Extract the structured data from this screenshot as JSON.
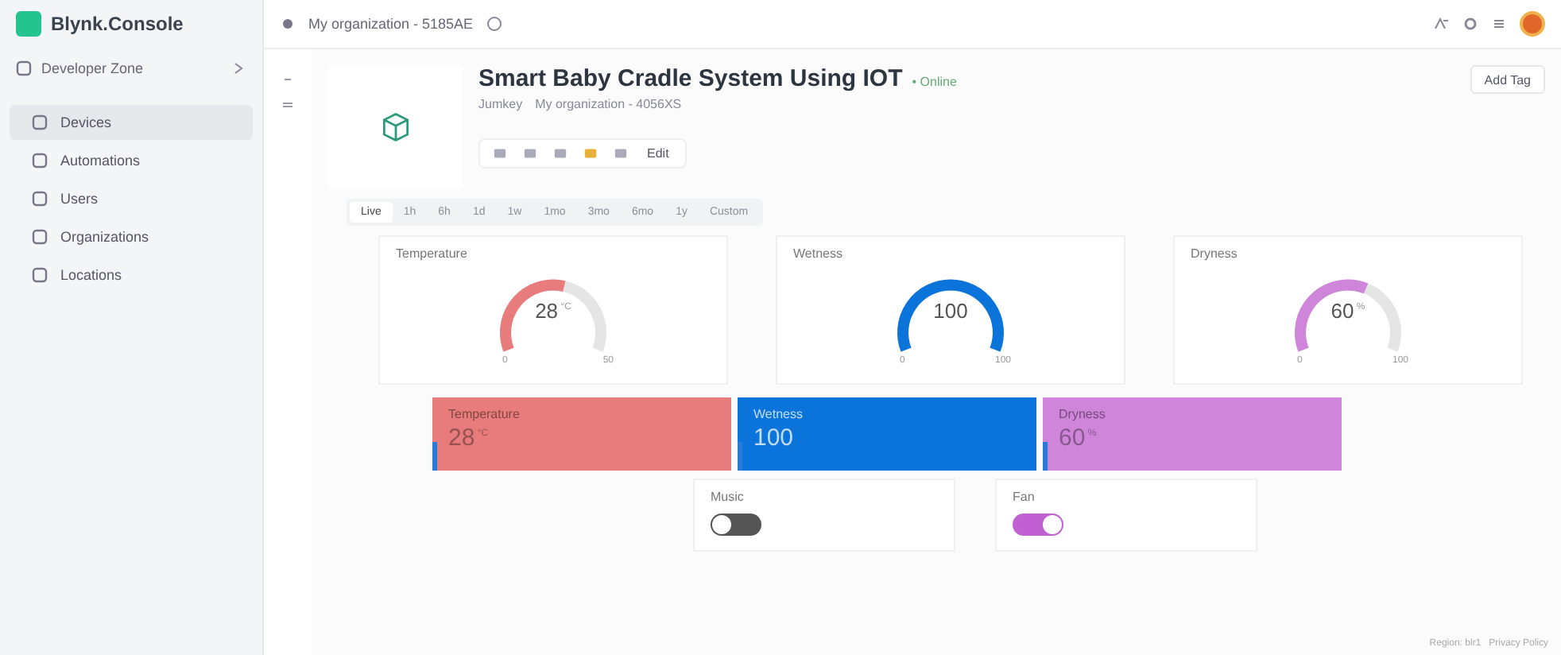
{
  "brand": {
    "name": "Blynk.Console"
  },
  "topbar": {
    "org": "My organization - 5185AE"
  },
  "sidebar": {
    "zone": "Developer Zone",
    "items": [
      {
        "label": "Devices",
        "selected": true
      },
      {
        "label": "Automations",
        "selected": false
      },
      {
        "label": "Users",
        "selected": false
      },
      {
        "label": "Organizations",
        "selected": false
      },
      {
        "label": "Locations",
        "selected": false
      }
    ]
  },
  "device": {
    "title": "Smart Baby Cradle System Using IOT",
    "status": "• Online",
    "owner": "Jumkey",
    "org": "My organization - 4056XS",
    "edit": "Edit",
    "add_tag": "Add Tag"
  },
  "time_tabs": [
    {
      "label": "Live",
      "selected": true
    },
    {
      "label": "1h",
      "selected": false
    },
    {
      "label": "6h",
      "selected": false
    },
    {
      "label": "1d",
      "selected": false
    },
    {
      "label": "1w",
      "selected": false
    },
    {
      "label": "1mo",
      "selected": false
    },
    {
      "label": "3mo",
      "selected": false
    },
    {
      "label": "6mo",
      "selected": false
    },
    {
      "label": "1y",
      "selected": false
    },
    {
      "label": "Custom",
      "selected": false
    }
  ],
  "gauges": [
    {
      "label": "Temperature",
      "value": "28",
      "unit": "°C",
      "min": "0",
      "max": "50"
    },
    {
      "label": "Wetness",
      "value": "100",
      "min": "0",
      "max": "100"
    },
    {
      "label": "Dryness",
      "value": "60",
      "unit": "%",
      "min": "0",
      "max": "100"
    }
  ],
  "value_displays": [
    {
      "label": "Temperature",
      "value": "28",
      "unit": "°C",
      "color": "#e87b7b"
    },
    {
      "label": "Wetness",
      "value": "100",
      "color": "#0a74da"
    },
    {
      "label": "Dryness",
      "value": "60",
      "unit": "%",
      "color": "#cf85da"
    }
  ],
  "switches": [
    {
      "label": "Music",
      "on": false
    },
    {
      "label": "Fan",
      "on": true
    }
  ],
  "footer": {
    "region": "Region: blr1",
    "privacy": "Privacy Policy"
  }
}
